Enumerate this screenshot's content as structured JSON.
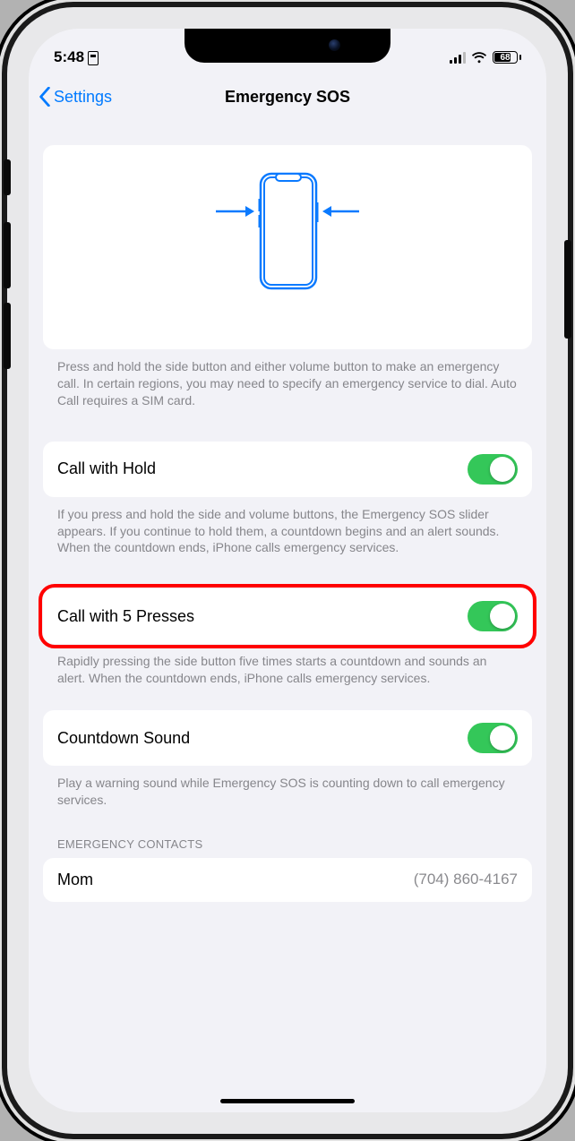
{
  "status": {
    "time": "5:48",
    "battery_pct": "68"
  },
  "nav": {
    "back_label": "Settings",
    "title": "Emergency SOS"
  },
  "hero_footer": "Press and hold the side button and either volume button to make an emergency call. In certain regions, you may need to specify an emergency service to dial. Auto Call requires a SIM card.",
  "call_hold": {
    "label": "Call with Hold",
    "on": true,
    "footer": "If you press and hold the side and volume buttons, the Emergency SOS slider appears. If you continue to hold them, a countdown begins and an alert sounds. When the countdown ends, iPhone calls emergency services."
  },
  "call_5": {
    "label": "Call with 5 Presses",
    "on": true,
    "footer": "Rapidly pressing the side button five times starts a countdown and sounds an alert. When the countdown ends, iPhone calls emergency services."
  },
  "countdown": {
    "label": "Countdown Sound",
    "on": true,
    "footer": "Play a warning sound while Emergency SOS is counting down to call emergency services."
  },
  "contacts_header": "EMERGENCY CONTACTS",
  "contacts": [
    {
      "name": "Mom",
      "phone": "(704) 860-4167"
    }
  ]
}
